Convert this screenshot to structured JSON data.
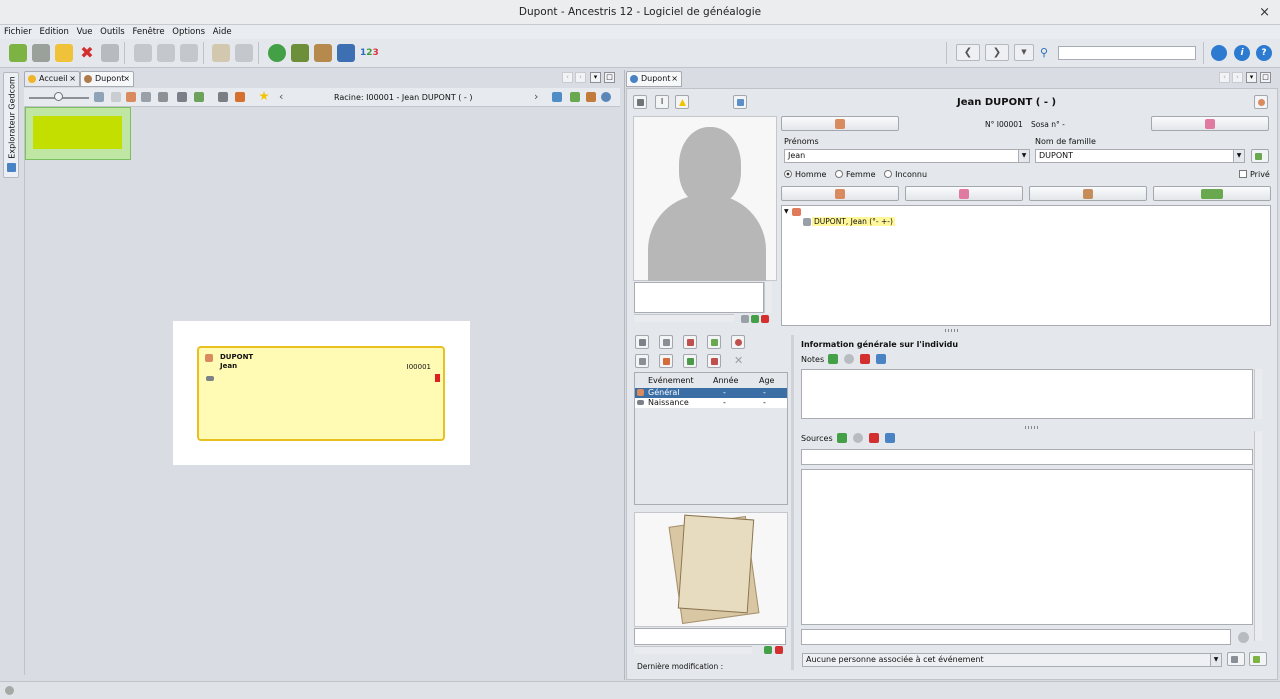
{
  "window": {
    "title": "Dupont - Ancestris 12 - Logiciel de généalogie",
    "close": "×"
  },
  "menu": [
    "Fichier",
    "Edition",
    "Vue",
    "Outils",
    "Fenêtre",
    "Options",
    "Aide"
  ],
  "side_tab": {
    "label": "Explorateur Gedcom"
  },
  "left": {
    "tabs": [
      {
        "label": "Accueil",
        "close": "×"
      },
      {
        "label": "Dupont",
        "close": "×"
      }
    ],
    "root_label": "Racine: I00001 - Jean DUPONT ( - )",
    "card": {
      "surname": "DUPONT",
      "given": "Jean",
      "id": "I00001"
    }
  },
  "right": {
    "tab": {
      "label": "Dupont",
      "close": "×"
    },
    "header_name": "Jean DUPONT ( - )",
    "id_label": "N° I00001",
    "sosa_label": "Sosa n° -",
    "given_label": "Prénoms",
    "given_value": "Jean",
    "surname_label": "Nom de famille",
    "surname_value": "DUPONT",
    "sex": {
      "male": "Homme",
      "female": "Femme",
      "unknown": "Inconnu",
      "selected": "Homme"
    },
    "private_label": "Privé",
    "tree_item": "DUPONT, Jean (°- +-)",
    "events": {
      "headers": [
        "Evénement",
        "Année",
        "Age"
      ],
      "rows": [
        {
          "name": "Général",
          "year": "-",
          "age": "-"
        },
        {
          "name": "Naissance",
          "year": "-",
          "age": "-"
        }
      ]
    },
    "info_title": "Information générale sur l'individu",
    "notes_label": "Notes",
    "sources_label": "Sources",
    "last_modified": "Dernière modification :",
    "assoc_select": "Aucune personne associée à cet événement"
  },
  "colors": {
    "accent": "#3a6ea5",
    "card_fill": "#fffbb5",
    "card_border": "#e8c020",
    "green_box": "#c3df00"
  }
}
